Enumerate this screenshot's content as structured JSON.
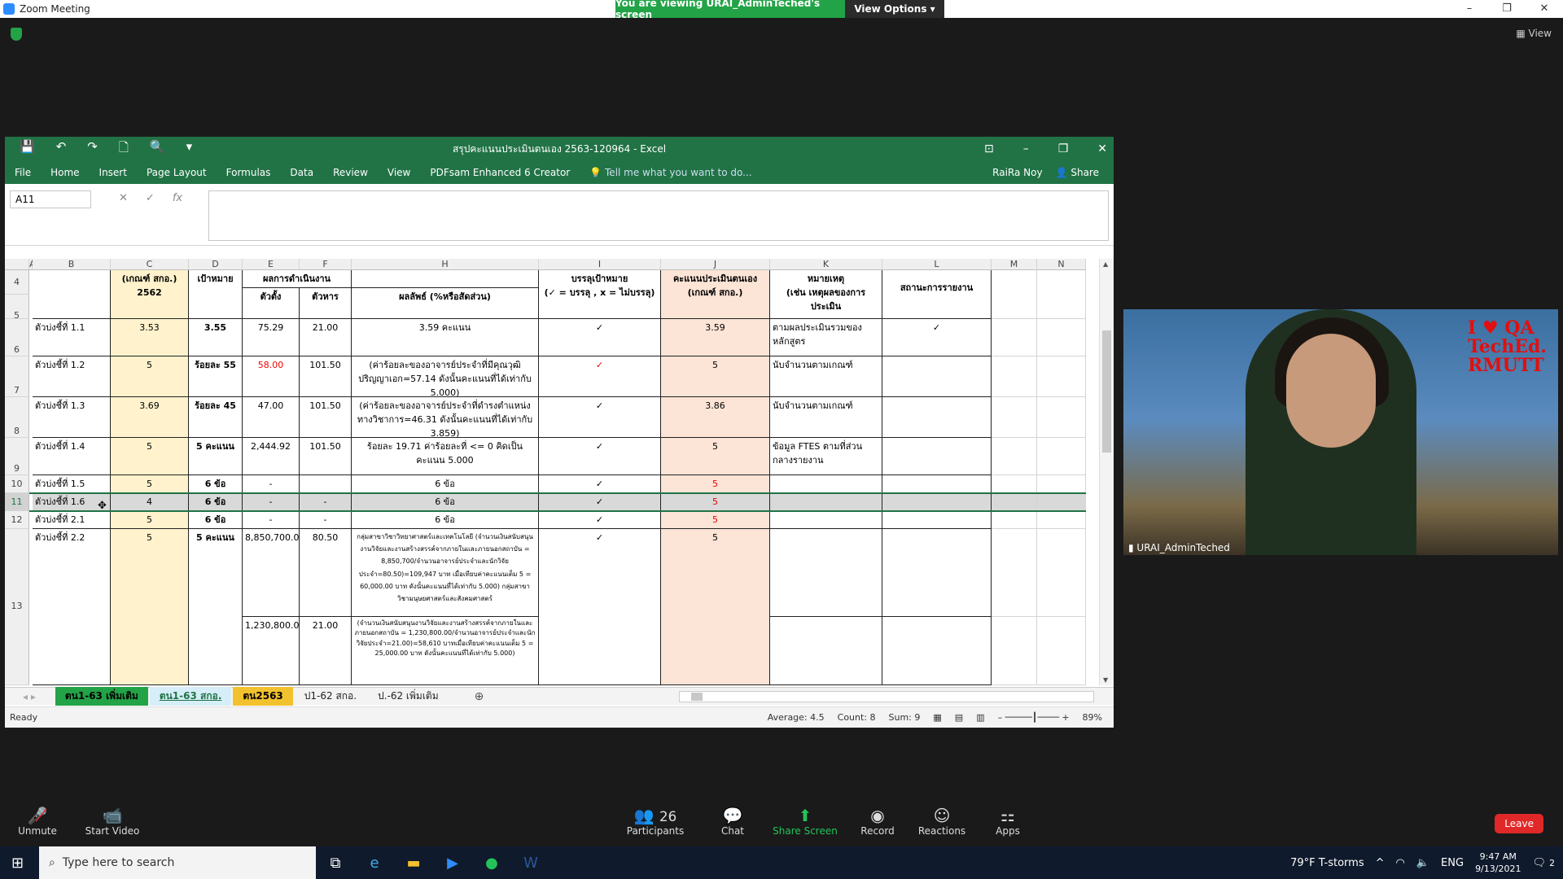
{
  "zoom": {
    "title": "Zoom Meeting",
    "viewing_banner": "You are viewing URAI_AdminTeched's screen",
    "view_options": "View Options",
    "view_label": "View"
  },
  "excel": {
    "title": "สรุปคะแนนประเมินตนเอง 2563-120964 - Excel",
    "ribbon_tabs": [
      "File",
      "Home",
      "Insert",
      "Page Layout",
      "Formulas",
      "Data",
      "Review",
      "View",
      "PDFsam Enhanced 6 Creator"
    ],
    "tell_me": "Tell me what you want to do...",
    "user": "RaiRa Noy",
    "share": "Share",
    "name_box": "A11",
    "columns": [
      "A",
      "B",
      "C",
      "D",
      "E",
      "F",
      "H",
      "I",
      "J",
      "K",
      "L",
      "M",
      "N"
    ],
    "rows": [
      "4",
      "5",
      "6",
      "7",
      "8",
      "9",
      "10",
      "11",
      "12",
      "13"
    ],
    "header": {
      "c": "(เกณฑ์ สกอ.)\n2562",
      "d": "เป้าหมาย",
      "ef": "ผลการดำเนินงาน",
      "e": "ตัวตั้ง",
      "f": "ตัวหาร",
      "h": "ผลลัพธ์ (%หรือสัดส่วน)",
      "i": "บรรลุเป้าหมาย\n(✓ = บรรลุ , x = ไม่บรรลุ)",
      "j": "คะแนนประเมินตนเอง\n(เกณฑ์ สกอ.)",
      "k": "หมายเหตุ\n(เช่น เหตุผลของการประเมิน",
      "l": "สถานะการรายงาน"
    },
    "data_rows": [
      {
        "b": "ตัวบ่งชี้ที่ 1.1",
        "c": "3.53",
        "d": "3.55",
        "e": "75.29",
        "f": "21.00",
        "h": "3.59 คะแนน",
        "i": "✓",
        "j": "3.59",
        "k": "ตามผลประเมินรวมของหลักสูตร",
        "l": "✓"
      },
      {
        "b": "ตัวบ่งชี้ที่ 1.2",
        "c": "5",
        "d": "ร้อยละ 55",
        "e": "58.00",
        "f": "101.50",
        "h": "(ค่าร้อยละของอาจารย์ประจำที่มีคุณวุฒิปริญญาเอก=57.14 ดังนั้นคะแนนที่ได้เท่ากับ 5.000)",
        "i": "✓",
        "j": "5",
        "k": "นับจำนวนตามเกณฑ์",
        "l": ""
      },
      {
        "b": "ตัวบ่งชี้ที่ 1.3",
        "c": "3.69",
        "d": "ร้อยละ 45",
        "e": "47.00",
        "f": "101.50",
        "h": "(ค่าร้อยละของอาจารย์ประจำที่ดำรงตำแหน่งทางวิชาการ=46.31 ดังนั้นคะแนนที่ได้เท่ากับ 3.859)",
        "i": "✓",
        "j": "3.86",
        "k": "นับจำนวนตามเกณฑ์",
        "l": ""
      },
      {
        "b": "ตัวบ่งชี้ที่ 1.4",
        "c": "5",
        "d": "5 คะแนน",
        "e": "2,444.92",
        "f": "101.50",
        "h": "ร้อยละ 19.71 ค่าร้อยละที่ <= 0 คิดเป็นคะแนน 5.000",
        "i": "✓",
        "j": "5",
        "k": "ข้อมูล FTES ตามที่ส่วนกลางรายงาน",
        "l": ""
      },
      {
        "b": "ตัวบ่งชี้ที่ 1.5",
        "c": "5",
        "d": "6 ข้อ",
        "e": "-",
        "f": "",
        "h": "6 ข้อ",
        "i": "✓",
        "j": "5",
        "k": "",
        "l": ""
      },
      {
        "b": "ตัวบ่งชี้ที่ 1.6",
        "c": "4",
        "d": "6 ข้อ",
        "e": "-",
        "f": "-",
        "h": "6 ข้อ",
        "i": "✓",
        "j": "5",
        "k": "",
        "l": ""
      },
      {
        "b": "ตัวบ่งชี้ที่ 2.1",
        "c": "5",
        "d": "6 ข้อ",
        "e": "-",
        "f": "-",
        "h": "6 ข้อ",
        "i": "✓",
        "j": "5",
        "k": "",
        "l": ""
      },
      {
        "b": "ตัวบ่งชี้ที่ 2.2",
        "c": "5",
        "d": "5 คะแนน",
        "e": "8,850,700.00",
        "f": "80.50",
        "h": "กลุ่มสาขาวิชาวิทยาศาสตร์และเทคโนโลยี (จำนวนเงินสนับสนุนงานวิจัยและงานสร้างสรรค์จากภายในและภายนอกสถาบัน = 8,850,700/จำนวนอาจารย์ประจำและนักวิจัยประจำ=80.50)=109,947 บาท เมื่อเทียบค่าคะแนนเต็ม 5 = 60,000.00 บาท ดังนั้นคะแนนที่ได้เท่ากับ 5.000) กลุ่มสาขาวิชามนุษยศาสตร์และสังคมศาสตร์",
        "i": "✓",
        "j": "5",
        "k": "",
        "l": ""
      },
      {
        "e": "1,230,800.00",
        "f": "21.00",
        "h": "(จำนวนเงินสนับสนุนงานวิจัยและงานสร้างสรรค์จากภายในและภายนอกสถาบัน = 1,230,800.00/จำนวนอาจารย์ประจำและนักวิจัยประจำ=21.00)=58,610 บาทเมื่อเทียบค่าคะแนนเต็ม 5 = 25,000.00 บาท ดังนั้นคะแนนที่ได้เท่ากับ 5.000)"
      }
    ],
    "sheet_tabs": [
      "ตน1-63 เพิ่มเติม",
      "ตน1-63 สกอ.",
      "ตน2563",
      "ป1-62 สกอ.",
      "ป.-62 เพิ่มเติม"
    ],
    "status": "Ready",
    "average": "Average: 4.5",
    "count": "Count: 8",
    "sum": "Sum: 9",
    "zoom": "89%"
  },
  "video": {
    "participant": "URAI_AdminTeched",
    "overlay_text": "I ♥ QA\nTechEd.\nRMUTT"
  },
  "toolbar": {
    "unmute": "Unmute",
    "start_video": "Start Video",
    "participants": "Participants",
    "participants_count": "26",
    "chat": "Chat",
    "share_screen": "Share Screen",
    "record": "Record",
    "reactions": "Reactions",
    "apps": "Apps",
    "leave": "Leave"
  },
  "taskbar": {
    "search_placeholder": "Type here to search",
    "weather": "79°F  T-storms",
    "lang": "ENG",
    "time": "9:47 AM",
    "date": "9/13/2021",
    "notifications": "2"
  },
  "colors": {
    "excel_green": "#217346",
    "zoom_green": "#23a347",
    "leave_red": "#e02828"
  }
}
